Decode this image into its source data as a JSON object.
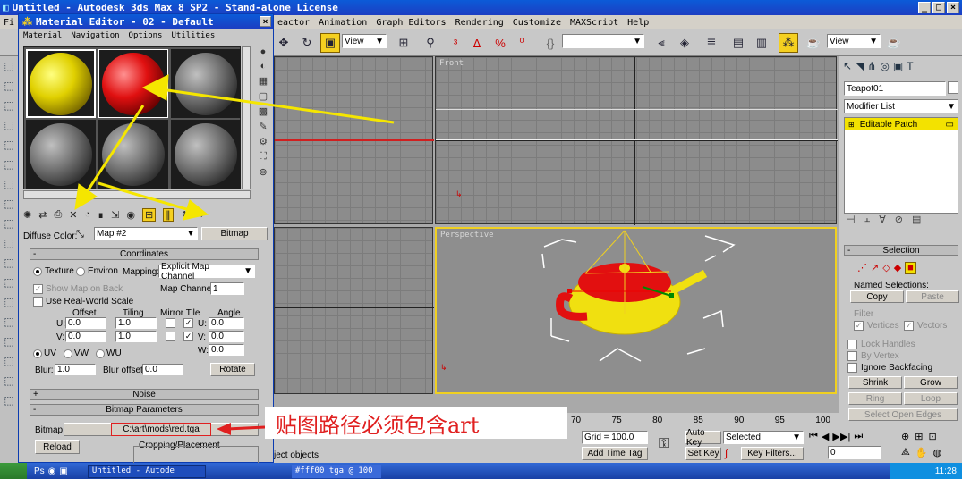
{
  "app": {
    "title": "Untitled - Autodesk 3ds Max 8 SP2 - Stand-alone License",
    "menu": [
      "eactor",
      "Animation",
      "Graph Editors",
      "Rendering",
      "Customize",
      "MAXScript",
      "Help"
    ],
    "view_dropdown_1": "View",
    "view_dropdown_2": "View",
    "status_text": "ject objects"
  },
  "material_editor": {
    "title": "Material Editor - 02 - Default",
    "menu": [
      "Material",
      "Navigation",
      "Options",
      "Utilities"
    ],
    "diffuse_label": "Diffuse Color:",
    "map_name": "Map #2",
    "bitmap_button": "Bitmap",
    "coordinates": {
      "header": "Coordinates",
      "texture": "Texture",
      "environ": "Environ",
      "mapping_label": "Mapping:",
      "mapping_value": "Explicit Map Channel",
      "show_map_on_back": "Show Map on Back",
      "map_channel_label": "Map Channel:",
      "map_channel_value": "1",
      "real_world": "Use Real-World Scale",
      "offset": "Offset",
      "tiling": "Tiling",
      "mirror_tile": "Mirror Tile",
      "angle": "Angle",
      "u": "U:",
      "v": "V:",
      "w": "W:",
      "u_offset": "0.0",
      "v_offset": "0.0",
      "u_tiling": "1.0",
      "v_tiling": "1.0",
      "u_angle": "0.0",
      "v_angle": "0.0",
      "w_angle": "0.0",
      "uv": "UV",
      "vw": "VW",
      "wu": "WU",
      "blur_label": "Blur:",
      "blur_value": "1.0",
      "blur_offset_label": "Blur offset:",
      "blur_offset_value": "0.0",
      "rotate": "Rotate"
    },
    "noise_header": "Noise",
    "bitmap_params": {
      "header": "Bitmap Parameters",
      "bitmap_label": "Bitmap:",
      "path": "C:\\art\\mods\\red.tga",
      "reload": "Reload",
      "cropping": "Cropping/Placement"
    }
  },
  "annotation": "贴图路径必须包含art",
  "viewports": {
    "front": "Front",
    "perspective": "Perspective"
  },
  "command_panel": {
    "object_name": "Teapot01",
    "modifier_list": "Modifier List",
    "stack_item": "Editable Patch",
    "selection_header": "Selection",
    "named_selections": "Named Selections:",
    "copy": "Copy",
    "paste": "Paste",
    "filter": "Filter",
    "vertices": "Vertices",
    "vectors": "Vectors",
    "lock_handles": "Lock Handles",
    "by_vertex": "By Vertex",
    "ignore_backfacing": "Ignore Backfacing",
    "shrink": "Shrink",
    "grow": "Grow",
    "ring": "Ring",
    "loop": "Loop",
    "select_open_edges": "Select Open Edges"
  },
  "timeline": {
    "ticks": [
      "70",
      "75",
      "80",
      "85",
      "90",
      "95",
      "100"
    ],
    "grid": "Grid = 100.0",
    "add_time_tag": "Add Time Tag",
    "auto_key": "Auto Key",
    "set_key": "Set Key",
    "selected": "Selected",
    "key_filters": "Key Filters...",
    "frame": "0"
  },
  "taskbar": {
    "item1": "Untitled - Autode",
    "item2": "#fff00 tga @ 100",
    "clock": "11:28"
  },
  "colors": {
    "annotation_red": "#e02020",
    "arrow_yellow": "#f5e600",
    "viewport_active": "#f0d020"
  }
}
